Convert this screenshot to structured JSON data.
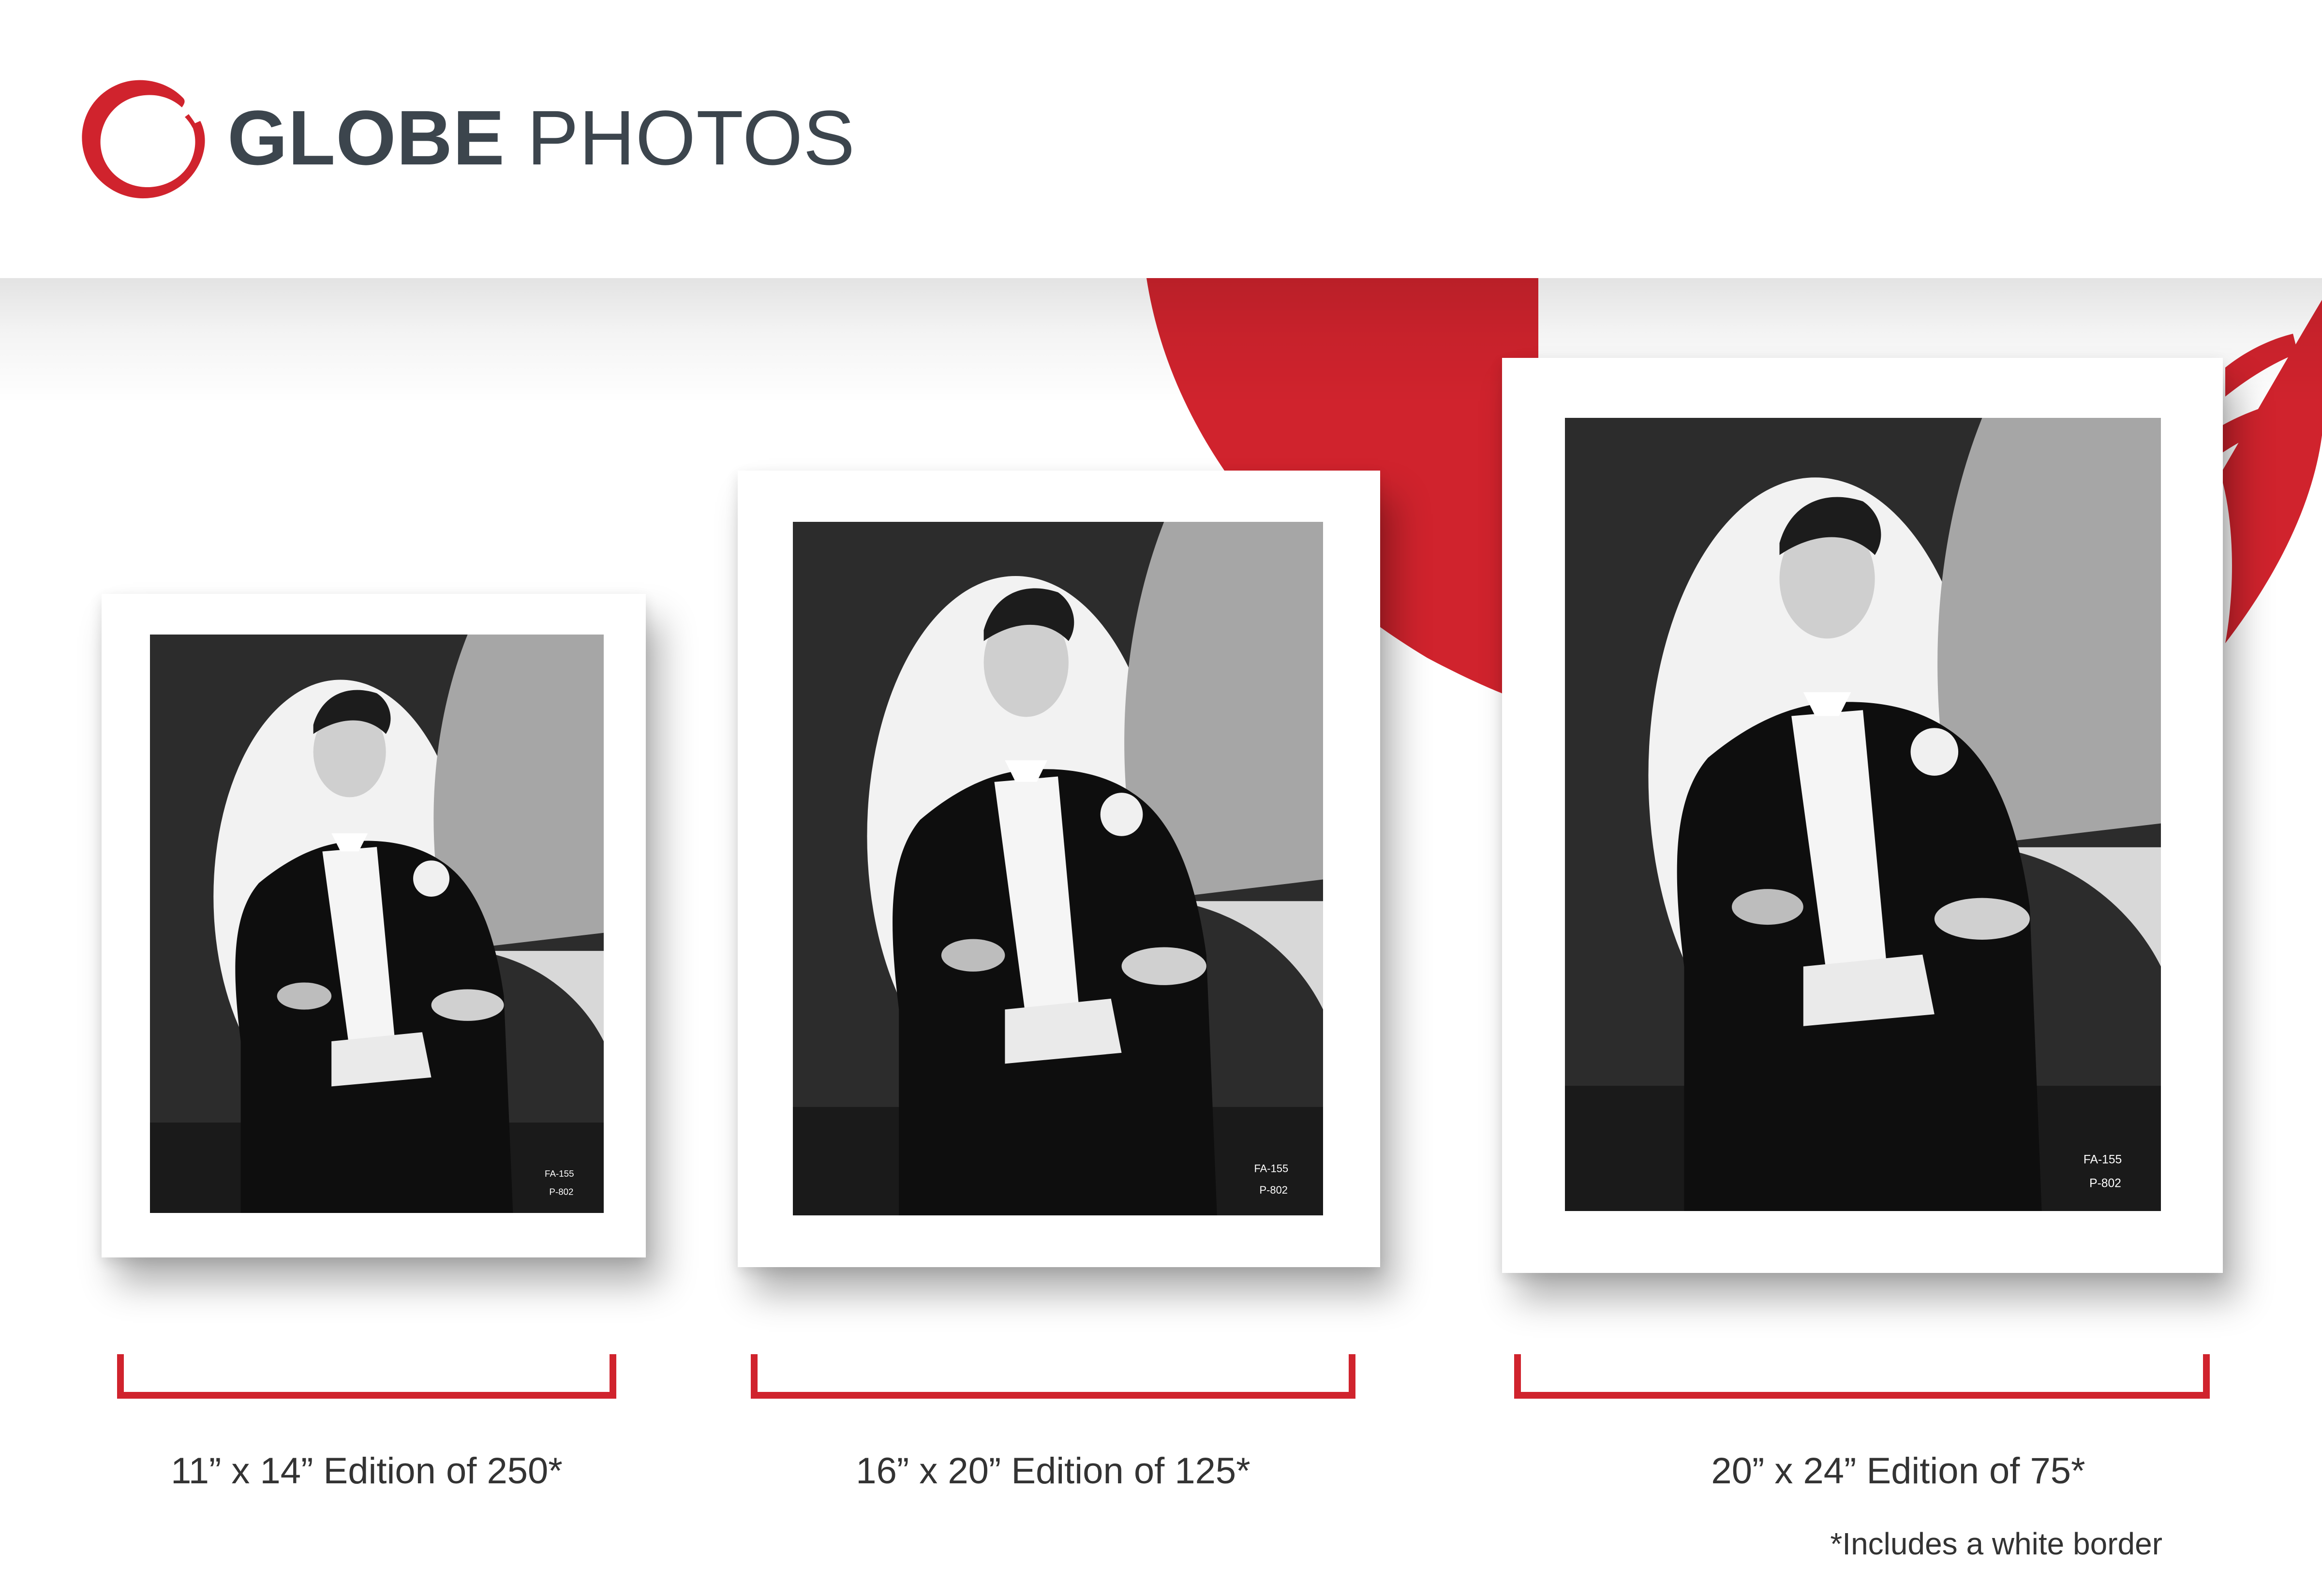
{
  "brand": {
    "name_bold": "GLOBE",
    "name_light": "PHOTOS",
    "mark_color": "#d0232d",
    "text_color": "#3c454d"
  },
  "photo_caption": {
    "code": "FA-155",
    "subcode": "P-802"
  },
  "editions": [
    {
      "label": "11” x 14” Edition of 250*"
    },
    {
      "label": "16” x 20” Edition of 125*"
    },
    {
      "label": "20” x 24” Edition of 75*"
    }
  ],
  "footnote": "*Includes a white border",
  "colors": {
    "accent": "#d0232d",
    "text": "#333333",
    "background": "#ffffff"
  }
}
